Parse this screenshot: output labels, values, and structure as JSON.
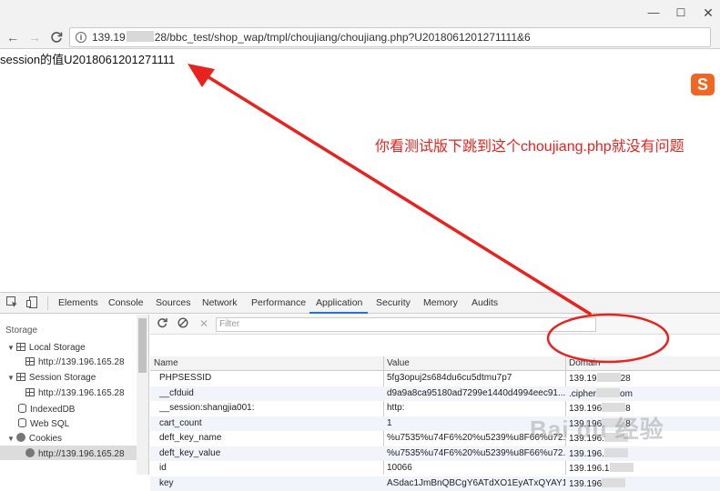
{
  "window": {
    "minimize": "—",
    "maximize": "☐",
    "close": "✕"
  },
  "toolbar": {
    "back": "←",
    "forward": "→",
    "reload": "C",
    "url_prefix": "139.19",
    "url_suffix": "28/bbc_test/shop_wap/tmpl/choujiang/choujiang.php?U2018061201271111&6"
  },
  "page": {
    "session_text": "session的值U2018061201271111",
    "annotation": "你看测试版下跳到这个choujiang.php就没有问题",
    "sogou_glyph": "S"
  },
  "colors": {
    "annotation": "#e8231f",
    "accent": "#1a73e8"
  },
  "devtools": {
    "tabs": [
      "Elements",
      "Console",
      "Sources",
      "Network",
      "Performance",
      "Application",
      "Security",
      "Memory",
      "Audits"
    ],
    "active_tab": "Application",
    "sidebar": {
      "storage": "Storage",
      "local_storage": "Local Storage",
      "local_storage_host": "http://139.196.165.28",
      "session_storage": "Session Storage",
      "session_storage_host": "http://139.196.165.28",
      "indexeddb": "IndexedDB",
      "websql": "Web SQL",
      "cookies": "Cookies",
      "cookies_host": "http://139.196.165.28"
    },
    "filter_placeholder": "Filter",
    "columns": [
      "Name",
      "Value",
      "Domain"
    ],
    "rows": [
      {
        "name": "PHPSESSID",
        "value": "5fg3opuj2s684du6cu5dtmu7p7",
        "domain_a": "139.19",
        "domain_b": "28"
      },
      {
        "name": "__cfduid",
        "value": "d9a9a8ca95180ad7299e1440d4994eec91...",
        "domain_a": ".cipher",
        "domain_b": "om"
      },
      {
        "name": "__session:shangjia001:",
        "value": "http:",
        "domain_a": "139.196",
        "domain_b": "8"
      },
      {
        "name": "cart_count",
        "value": "1",
        "domain_a": "139.196",
        "domain_b": "8"
      },
      {
        "name": "deft_key_name",
        "value": "%u7535%u74F6%20%u5239%u8F66%u72...",
        "domain_a": "139.196.",
        "domain_b": ""
      },
      {
        "name": "deft_key_value",
        "value": "%u7535%u74F6%20%u5239%u8F66%u72...",
        "domain_a": "139.196.",
        "domain_b": ""
      },
      {
        "name": "id",
        "value": "10066",
        "domain_a": "139.196.1",
        "domain_b": ""
      },
      {
        "name": "key",
        "value": "ASdac1JmBnQBCgY6ATdXO1EyATxQYAY1...",
        "domain_a": "139.196",
        "domain_b": ""
      }
    ]
  },
  "watermark": "Bai du 经验"
}
